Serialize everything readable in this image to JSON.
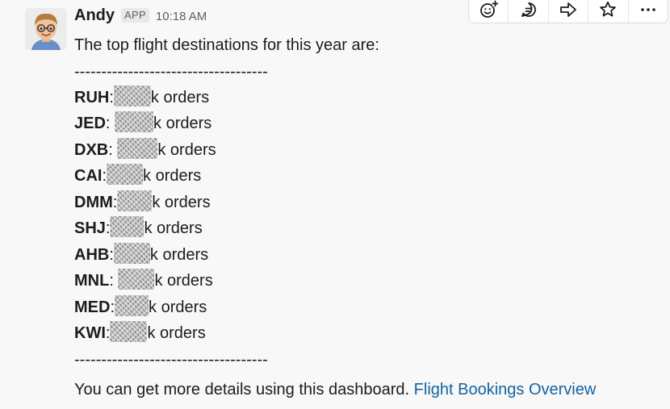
{
  "message": {
    "author": "Andy",
    "badge": "APP",
    "timestamp": "10:18 AM",
    "intro": "The top flight destinations for this year are:",
    "divider": "------------------------------------",
    "suffix": "k orders",
    "destinations": [
      {
        "code": "RUH",
        "sep": ":"
      },
      {
        "code": "JED",
        "sep": ": "
      },
      {
        "code": "DXB",
        "sep": ": "
      },
      {
        "code": "CAI",
        "sep": ":"
      },
      {
        "code": "DMM",
        "sep": ":"
      },
      {
        "code": "SHJ",
        "sep": ":"
      },
      {
        "code": "AHB",
        "sep": ":"
      },
      {
        "code": "MNL",
        "sep": ": "
      },
      {
        "code": "MED",
        "sep": ":"
      },
      {
        "code": "KWI",
        "sep": ":"
      }
    ],
    "footer_text": "You can get more details using this dashboard. ",
    "footer_link": "Flight Bookings Overview"
  },
  "toolbar": {
    "buttons": [
      {
        "icon": "add-reaction-icon"
      },
      {
        "icon": "reply-in-thread-icon"
      },
      {
        "icon": "share-message-icon"
      },
      {
        "icon": "save-star-icon"
      },
      {
        "icon": "more-actions-icon"
      }
    ]
  },
  "colors": {
    "background": "#f8f8f8",
    "link": "#1264a3",
    "text": "#1d1c1d",
    "muted": "#616061"
  }
}
